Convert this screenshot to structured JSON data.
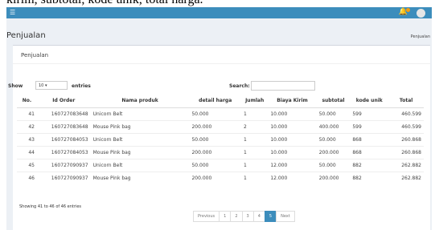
{
  "caption": "kirim, subtotal, kode unik, total harga.",
  "header": {
    "menu_icon": "hamburger-icon",
    "bell_icon": "bell-icon",
    "avatar_icon": "user-avatar-icon",
    "brand_color": "#3c8dbc",
    "badge_color": "#f39c12"
  },
  "page": {
    "title": "Penjualan",
    "breadcrumb": "Penjualan"
  },
  "box": {
    "title": "Penjualan"
  },
  "controls": {
    "show_label": "Show",
    "length_value": "10",
    "entries_label": "entries",
    "search_label": "Search:",
    "search_value": ""
  },
  "table": {
    "columns": [
      "No.",
      "Id Order",
      "Nama produk",
      "detail harga",
      "Jumlah",
      "Biaya Kirim",
      "subtotal",
      "kode unik",
      "Total"
    ],
    "rows": [
      [
        "41",
        "160727083648",
        "Unicorn Belt",
        "50.000",
        "1",
        "10.000",
        "50.000",
        "599",
        "460.599"
      ],
      [
        "42",
        "160727083648",
        "Mouse Pink bag",
        "200.000",
        "2",
        "10.000",
        "400.000",
        "599",
        "460.599"
      ],
      [
        "43",
        "160727084053",
        "Unicorn Belt",
        "50.000",
        "1",
        "10.000",
        "50.000",
        "868",
        "260.868"
      ],
      [
        "44",
        "160727084053",
        "Mouse Pink bag",
        "200.000",
        "1",
        "10.000",
        "200.000",
        "868",
        "260.868"
      ],
      [
        "45",
        "160727090937",
        "Unicorn Belt",
        "50.000",
        "1",
        "12.000",
        "50.000",
        "882",
        "262.882"
      ],
      [
        "46",
        "160727090937",
        "Mouse Pink bag",
        "200.000",
        "1",
        "12.000",
        "200.000",
        "882",
        "262.882"
      ]
    ]
  },
  "footer": {
    "info": "Showing 41 to 46 of 46 entries",
    "pagination": [
      "Previous",
      "1",
      "2",
      "3",
      "4",
      "5",
      "Next"
    ],
    "active_page": "5"
  }
}
